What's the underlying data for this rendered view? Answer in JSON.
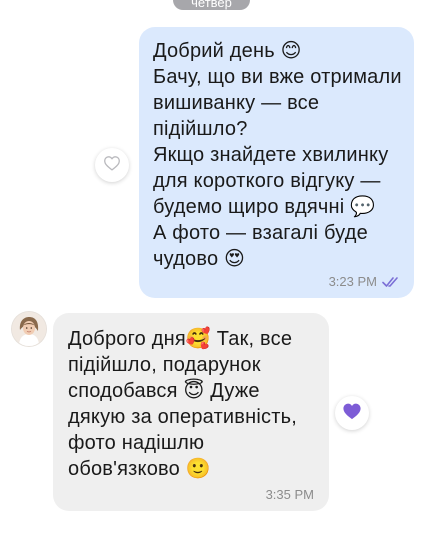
{
  "date_separator": "четвер",
  "messages": [
    {
      "direction": "outgoing",
      "text": "Добрий день 😊\nБачу, що ви вже отримали вишиванку — все підійшло?\nЯкщо знайдете хвилинку для короткого відгуку — будемо щиро вдячні 💬\nА фото — взагалі буде чудово 😍",
      "time": "3:23 PM",
      "status_icon": "double-check-icon",
      "reaction_icon": "heart-outline-icon"
    },
    {
      "direction": "incoming",
      "text": "Доброго дня🥰 Так, все підійшло, подарунок сподобався 😇 Дуже дякую за оперативність, фото надішлю обов'язково 🙂",
      "time": "3:35 PM",
      "reaction_icon": "purple-heart-icon",
      "avatar_icon": "contact-avatar"
    }
  ],
  "colors": {
    "outgoing_bubble": "#dbe9fd",
    "incoming_bubble": "#efefef",
    "timestamp": "#8c8c8c",
    "read_check": "#7b6fd6",
    "reaction_heart": "#7d5cd6"
  }
}
